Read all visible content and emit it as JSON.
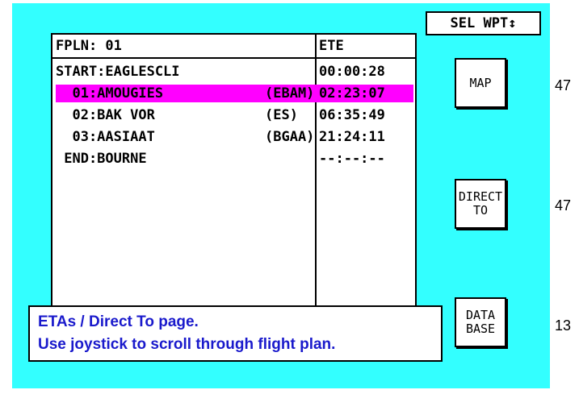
{
  "header": {
    "sel_wpt": "SEL WPT↕"
  },
  "fpln": {
    "title": "FPLN: 01",
    "ete_header": "ETE",
    "rows": [
      {
        "name": "START:EAGLESCLI",
        "code": "",
        "ete": "00:00:28"
      },
      {
        "name": "  01:AMOUGIES",
        "code": "(EBAM)",
        "ete": "02:23:07"
      },
      {
        "name": "  02:BAK VOR",
        "code": "(ES)",
        "ete": "06:35:49"
      },
      {
        "name": "  03:AASIAAT",
        "code": "(BGAA)",
        "ete": "21:24:11"
      },
      {
        "name": " END:BOURNE",
        "code": "",
        "ete": "--:--:--"
      }
    ],
    "highlight_color": "#ff00ff"
  },
  "side_buttons": [
    {
      "label": "MAP",
      "number": "47"
    },
    {
      "label": "DIRECT\nTO",
      "number": "47"
    },
    {
      "label": "DATA\nBASE",
      "number": "13"
    }
  ],
  "message": {
    "line1": "ETAs / Direct To page.",
    "line2": "Use joystick to scroll through flight plan."
  },
  "colors": {
    "screen_bg": "#33ffff",
    "message_text": "#1a1acc"
  }
}
